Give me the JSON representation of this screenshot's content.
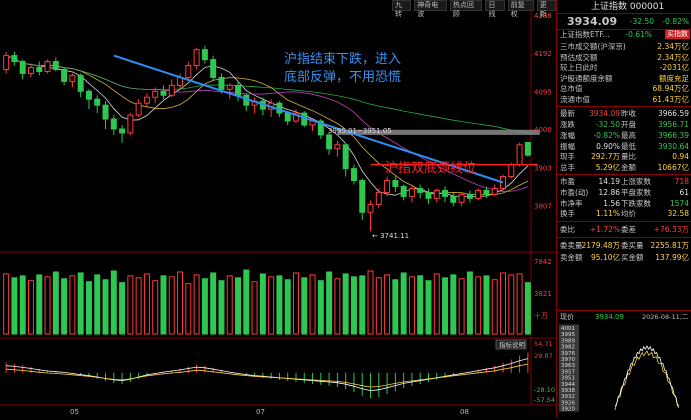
{
  "toolbar": {
    "buttons": [
      "九转",
      "神奇电波",
      "热点回顾",
      "日线",
      "前复权",
      "更新"
    ]
  },
  "annotations": {
    "top_text_line1": "沪指结束下跌，进入",
    "top_text_line2": "底部反弹，不用恐慌",
    "neckline_text": "沪指双底颈线位",
    "range_label": "3995.01~3951.05",
    "low_label": "3741.11",
    "indicator_button": "指标说明"
  },
  "axes": {
    "price_ticks": [
      "4288",
      "4192",
      "4095",
      "4000",
      "3903",
      "3807"
    ],
    "volume_ticks": [
      "7842",
      "3821",
      "十万"
    ],
    "macd_ticks": [
      "54.71",
      "29.87",
      "-28.10",
      "-57.54"
    ],
    "date_ticks": [
      "05",
      "07",
      "08"
    ]
  },
  "quote": {
    "title": "上证指数 000001",
    "price": "3934.09",
    "change": "-32.50",
    "pct": "-0.82%",
    "etf_name": "上证指数ETF...",
    "etf_pct": "-0.61%",
    "etf_badge": "买指数"
  },
  "fund_rows": [
    {
      "label": "三市成交额(沪深京)",
      "value": "2.34万亿"
    },
    {
      "label": "预估成交额",
      "value": "2.34万亿"
    },
    {
      "label": "较上日此时",
      "value": "-2031亿"
    },
    {
      "label": "沪股通额度余额",
      "value": "额度充足"
    },
    {
      "label": "总市值",
      "value": "68.94万亿"
    },
    {
      "label": "流通市值",
      "value": "61.43万亿"
    }
  ],
  "stats": [
    {
      "l1": "最新",
      "v1": "3934.09",
      "c1": "up",
      "l2": "昨收",
      "v2": "3966.59",
      "c2": "wh"
    },
    {
      "l1": "涨跌",
      "v1": "-32.50",
      "c1": "dn",
      "l2": "开盘",
      "v2": "3956.71",
      "c2": "dn"
    },
    {
      "l1": "涨幅",
      "v1": "-0.82%",
      "c1": "dn",
      "l2": "最高",
      "v2": "3966.39",
      "c2": "dn"
    },
    {
      "l1": "振幅",
      "v1": "0.90%",
      "c1": "wh",
      "l2": "最低",
      "v2": "3930.64",
      "c2": "dn"
    },
    {
      "l1": "现手",
      "v1": "292.7万",
      "c1": "yl",
      "l2": "量比",
      "v2": "0.94",
      "c2": "yl"
    },
    {
      "l1": "总手",
      "v1": "5.29亿",
      "c1": "yl",
      "l2": "金额",
      "v2": "10667亿",
      "c2": "yl"
    },
    {
      "l1": "市盈",
      "v1": "14.19",
      "c1": "wh",
      "l2": "上涨家数",
      "v2": "718",
      "c2": "up"
    },
    {
      "l1": "市盈(动)",
      "v1": "12.86",
      "c1": "wh",
      "l2": "平盘家数",
      "v2": "61",
      "c2": "wh"
    },
    {
      "l1": "市净率",
      "v1": "1.56",
      "c1": "wh",
      "l2": "下跌家数",
      "v2": "1574",
      "c2": "dn"
    },
    {
      "l1": "换手",
      "v1": "1.11%",
      "c1": "yl",
      "l2": "均价",
      "v2": "32.58",
      "c2": "yl"
    }
  ],
  "wei": {
    "l1": "委比",
    "v1": "+1.72%",
    "l2": "委差",
    "v2": "+76.33万"
  },
  "orders": [
    {
      "l1": "委卖量",
      "v1": "2179.48万",
      "l2": "委买量",
      "v2": "2255.81万"
    },
    {
      "l1": "卖金额",
      "v1": "95.10亿",
      "l2": "买金额",
      "v2": "137.99亿"
    }
  ],
  "mini": {
    "label": "现价",
    "price": "3934.09",
    "date": "2026-08-11,二",
    "ticks": [
      "4001",
      "3995",
      "3989",
      "3982",
      "3976",
      "3970",
      "3963",
      "3957",
      "3951",
      "3944",
      "3938",
      "3932",
      "3926",
      "3920",
      "3967",
      "3951"
    ]
  },
  "colors": {
    "up": "#ff3b3b",
    "down": "#2ec850",
    "neck": "#ff2020",
    "trend": "#2f8df2",
    "label": "#3a8ff0"
  },
  "chart_data": {
    "type": "candlestick",
    "price_range": [
      3720,
      4300
    ],
    "candles": [
      [
        4150,
        4185,
        4140,
        4195,
        "up"
      ],
      [
        4185,
        4170,
        4160,
        4195,
        "dn"
      ],
      [
        4170,
        4140,
        4125,
        4175,
        "dn"
      ],
      [
        4140,
        4155,
        4130,
        4165,
        "up"
      ],
      [
        4155,
        4145,
        4135,
        4170,
        "dn"
      ],
      [
        4145,
        4170,
        4140,
        4175,
        "up"
      ],
      [
        4170,
        4150,
        4145,
        4180,
        "dn"
      ],
      [
        4150,
        4120,
        4110,
        4155,
        "dn"
      ],
      [
        4120,
        4135,
        4105,
        4140,
        "up"
      ],
      [
        4135,
        4095,
        4080,
        4140,
        "dn"
      ],
      [
        4095,
        4075,
        4050,
        4100,
        "dn"
      ],
      [
        4075,
        4060,
        4040,
        4085,
        "dn"
      ],
      [
        4060,
        4025,
        4000,
        4070,
        "dn"
      ],
      [
        4025,
        4000,
        3985,
        4035,
        "dn"
      ],
      [
        4000,
        3990,
        3965,
        4010,
        "dn"
      ],
      [
        3990,
        4035,
        3985,
        4040,
        "up"
      ],
      [
        4035,
        4065,
        4030,
        4075,
        "up"
      ],
      [
        4065,
        4080,
        4055,
        4090,
        "up"
      ],
      [
        4080,
        4095,
        4065,
        4105,
        "up"
      ],
      [
        4095,
        4085,
        4075,
        4110,
        "dn"
      ],
      [
        4085,
        4110,
        4080,
        4125,
        "up"
      ],
      [
        4110,
        4130,
        4100,
        4140,
        "up"
      ],
      [
        4130,
        4160,
        4120,
        4170,
        "up"
      ],
      [
        4160,
        4200,
        4150,
        4205,
        "up"
      ],
      [
        4200,
        4175,
        4165,
        4210,
        "dn"
      ],
      [
        4175,
        4130,
        4120,
        4185,
        "dn"
      ],
      [
        4130,
        4100,
        4090,
        4140,
        "dn"
      ],
      [
        4100,
        4110,
        4075,
        4115,
        "up"
      ],
      [
        4110,
        4085,
        4070,
        4120,
        "dn"
      ],
      [
        4085,
        4060,
        4045,
        4090,
        "dn"
      ],
      [
        4060,
        4070,
        4040,
        4080,
        "up"
      ],
      [
        4070,
        4050,
        4035,
        4080,
        "dn"
      ],
      [
        4050,
        4065,
        4030,
        4075,
        "up"
      ],
      [
        4065,
        4040,
        4030,
        4070,
        "dn"
      ],
      [
        4040,
        4020,
        4010,
        4045,
        "dn"
      ],
      [
        4020,
        4040,
        4015,
        4050,
        "up"
      ],
      [
        4040,
        4010,
        4005,
        4045,
        "dn"
      ],
      [
        4010,
        4020,
        3995,
        4025,
        "up"
      ],
      [
        4020,
        3985,
        3975,
        4025,
        "dn"
      ],
      [
        3985,
        3950,
        3935,
        3990,
        "dn"
      ],
      [
        3950,
        3960,
        3930,
        3970,
        "up"
      ],
      [
        3960,
        3900,
        3880,
        3965,
        "dn"
      ],
      [
        3900,
        3870,
        3860,
        3910,
        "dn"
      ],
      [
        3870,
        3790,
        3770,
        3875,
        "dn"
      ],
      [
        3790,
        3810,
        3742,
        3820,
        "up"
      ],
      [
        3810,
        3840,
        3800,
        3850,
        "up"
      ],
      [
        3840,
        3870,
        3830,
        3880,
        "up"
      ],
      [
        3870,
        3855,
        3840,
        3880,
        "dn"
      ],
      [
        3855,
        3830,
        3820,
        3860,
        "dn"
      ],
      [
        3830,
        3850,
        3815,
        3860,
        "up"
      ],
      [
        3850,
        3840,
        3825,
        3860,
        "dn"
      ],
      [
        3840,
        3825,
        3810,
        3850,
        "dn"
      ],
      [
        3825,
        3845,
        3815,
        3850,
        "up"
      ],
      [
        3845,
        3830,
        3815,
        3855,
        "dn"
      ],
      [
        3830,
        3815,
        3805,
        3840,
        "dn"
      ],
      [
        3815,
        3835,
        3805,
        3840,
        "up"
      ],
      [
        3835,
        3825,
        3815,
        3845,
        "dn"
      ],
      [
        3825,
        3845,
        3820,
        3850,
        "up"
      ],
      [
        3845,
        3835,
        3825,
        3855,
        "dn"
      ],
      [
        3835,
        3850,
        3830,
        3860,
        "up"
      ],
      [
        3850,
        3880,
        3845,
        3885,
        "up"
      ],
      [
        3880,
        3910,
        3875,
        3915,
        "up"
      ],
      [
        3910,
        3960,
        3905,
        3965,
        "up"
      ],
      [
        3966,
        3934,
        3930,
        3967,
        "dn"
      ]
    ],
    "neckline": 3910,
    "volume": [
      6.2,
      5.8,
      6.0,
      5.5,
      6.1,
      5.9,
      6.4,
      5.7,
      6.0,
      6.3,
      5.4,
      6.1,
      5.6,
      6.5,
      5.3,
      6.0,
      5.8,
      6.2,
      5.5,
      6.0,
      5.9,
      6.4,
      5.2,
      6.1,
      5.7,
      6.3,
      5.5,
      6.0,
      5.8,
      6.6,
      5.4,
      6.2,
      5.9,
      6.0,
      5.6,
      6.3,
      5.8,
      6.1,
      5.5,
      6.4,
      5.7,
      6.2,
      5.9,
      6.0,
      6.5,
      5.8,
      6.1,
      5.6,
      6.3,
      5.9,
      6.0,
      5.5,
      6.2,
      5.8,
      6.1,
      5.7,
      6.4,
      5.9,
      6.0,
      5.6,
      6.3,
      6.1,
      6.2,
      5.3
    ],
    "volume_max": 7.842,
    "macd": [
      20,
      18,
      15,
      12,
      8,
      5,
      3,
      1,
      -2,
      -5,
      -8,
      -12,
      -16,
      -20,
      -22,
      -18,
      -12,
      -6,
      -2,
      2,
      5,
      8,
      12,
      16,
      14,
      10,
      6,
      2,
      -2,
      -5,
      -8,
      -10,
      -12,
      -14,
      -16,
      -18,
      -20,
      -22,
      -24,
      -26,
      -28,
      -32,
      -38,
      -45,
      -50,
      -48,
      -42,
      -36,
      -30,
      -26,
      -22,
      -18,
      -14,
      -10,
      -6,
      -2,
      2,
      6,
      10,
      14,
      20,
      26,
      34,
      40
    ],
    "macd_range": [
      -57.54,
      54.71
    ]
  }
}
